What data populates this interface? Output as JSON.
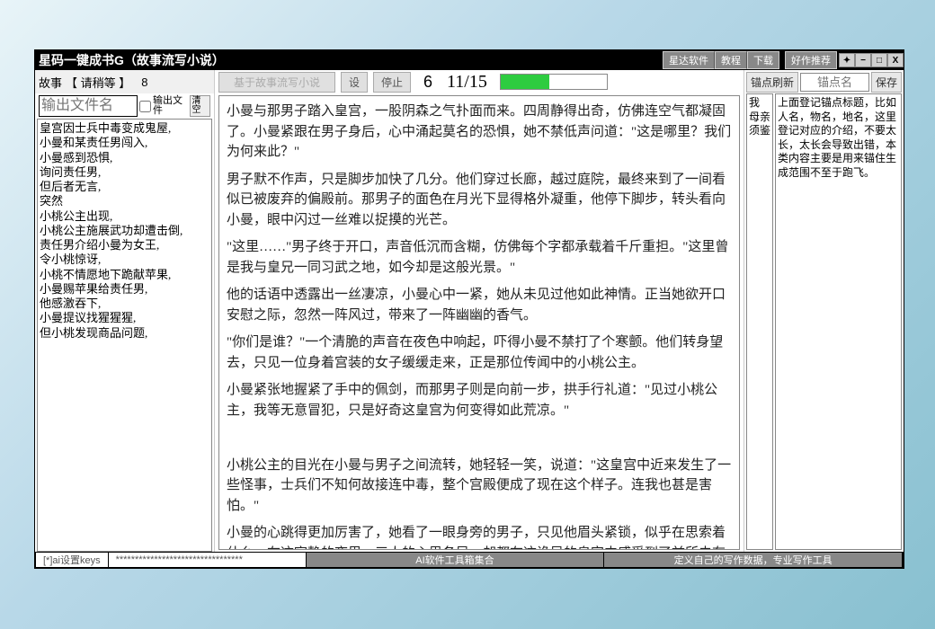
{
  "window": {
    "title": "星码一键成书G（故事流写小说）",
    "tabs": [
      "星达软件",
      "教程",
      "下载",
      "好作推荐"
    ]
  },
  "toolbar": {
    "story_label": "故事",
    "wait_status": "【 请稍等 】",
    "wait_num": "8"
  },
  "outfile": {
    "placeholder": "输出文件名",
    "checkbox_label": "输出文件",
    "clear_label": "清空"
  },
  "outline": [
    "皇宫因士兵中毒变成鬼屋,",
    "小曼和某责任男闯入,",
    "小曼感到恐惧,",
    "询问责任男,",
    "但后者无言,",
    "突然",
    "小桃公主出现,",
    "小桃公主施展武功却遭击倒,",
    "责任男介绍小曼为女王,",
    "令小桃惊讶,",
    "小桃不情愿地下跪献苹果,",
    "小曼赐苹果给责任男,",
    "他感激吞下,",
    "小曼提议找猩猩猩,",
    "但小桃发现商品问题,"
  ],
  "center": {
    "run_label": "基于故事流写小说",
    "setting_label": "设",
    "stop_label": "停止",
    "count": "6",
    "fraction": "11/15"
  },
  "story_paragraphs": [
    "小曼与那男子踏入皇宫，一股阴森之气扑面而来。四周静得出奇，仿佛连空气都凝固了。小曼紧跟在男子身后，心中涌起莫名的恐惧，她不禁低声问道：\"这是哪里？我们为何来此？\"",
    "男子默不作声，只是脚步加快了几分。他们穿过长廊，越过庭院，最终来到了一间看似已被废弃的偏殿前。那男子的面色在月光下显得格外凝重，他停下脚步，转头看向小曼，眼中闪过一丝难以捉摸的光芒。",
    "\"这里……\"男子终于开口，声音低沉而含糊，仿佛每个字都承载着千斤重担。\"这里曾是我与皇兄一同习武之地，如今却是这般光景。\"",
    "他的话语中透露出一丝凄凉，小曼心中一紧，她从未见过他如此神情。正当她欲开口安慰之际，忽然一阵风过，带来了一阵幽幽的香气。",
    "\"你们是谁？\"一个清脆的声音在夜色中响起，吓得小曼不禁打了个寒颤。他们转身望去，只见一位身着宫装的女子缓缓走来，正是那位传闻中的小桃公主。",
    "小曼紧张地握紧了手中的佩剑，而那男子则是向前一步，拱手行礼道：\"见过小桃公主，我等无意冒犯，只是好奇这皇宫为何变得如此荒凉。\"",
    "",
    "小桃公主的目光在小曼与男子之间流转，她轻轻一笑，说道：\"这皇宫中近来发生了一些怪事，士兵们不知何故接连中毒，整个宫殿便成了现在这个样子。连我也甚是害怕。\"",
    "小曼的心跳得更加厉害了，她看了一眼身旁的男子，只见他眉头紧锁，似乎在思索着什么。在这寂静的夜里，三人的心思各异，却都在这诡异的皇宫中感受到了前所未有的压力。"
  ],
  "right": {
    "refresh_label": "锚点刷新",
    "anchor_placeholder": "锚点名",
    "save_label": "保存",
    "left_col": "我\n母亲\n须鉴",
    "right_col": "上面登记锚点标题，比如人名，物名，地名，这里登记对应的介绍，不要太长，太长会导致出错，本类内容主要是用来锚住生成范围不至于跑飞。"
  },
  "statusbar": {
    "keys": "[*]ai设置keys",
    "mask": "*********************************",
    "toolbox": "AI软件工具箱集合",
    "define": "定义自己的写作数据，专业写作工具"
  }
}
